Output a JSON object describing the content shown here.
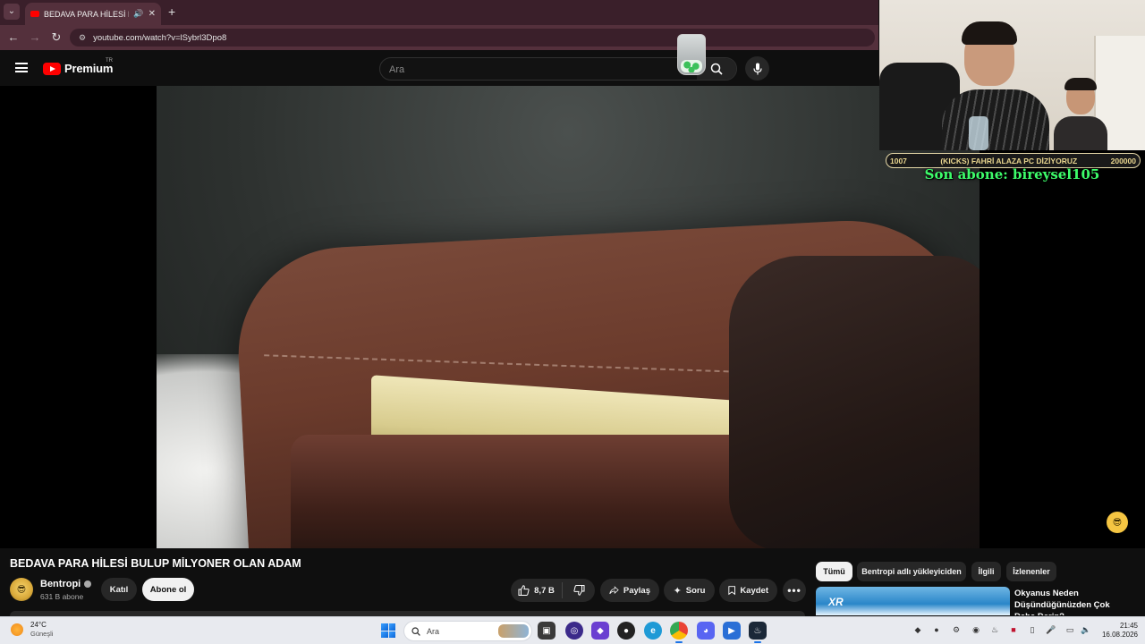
{
  "browser": {
    "tab_title": "BEDAVA PARA HİLESİ BULUP",
    "new_tab_symbol": "+",
    "url": "youtube.com/watch?v=lSybrl3Dpo8"
  },
  "youtube": {
    "logo_text": "Premium",
    "logo_region": "TR",
    "search_placeholder": "Ara"
  },
  "stream_overlay": {
    "goal_current": "1007",
    "goal_title": "(KICKS) FAHRİ ALAZA PC DİZİYORUZ",
    "goal_target": "200000",
    "last_subscriber": "Son abone: bireysel105"
  },
  "video": {
    "title": "BEDAVA PARA HİLESİ BULUP MİLYONER OLAN ADAM",
    "channel_name": "Bentropi",
    "channel_subs": "631 B abone",
    "join_label": "Katıl",
    "subscribe_label": "Abone ol",
    "like_count": "8,7 B",
    "share_label": "Paylaş",
    "ask_label": "Soru",
    "save_label": "Kaydet"
  },
  "sidebar": {
    "chips": [
      "Tümü",
      "Bentropi adlı yükleyiciden",
      "İlgili",
      "İzlenenler"
    ],
    "recommendation": {
      "thumb_text": "XR",
      "title": "Okyanus Neden Düşündüğünüzden Çok Daha Derin?"
    }
  },
  "taskbar": {
    "weather_temp": "24°C",
    "weather_condition": "Güneşli",
    "search_placeholder": "Ara",
    "time": "21:45",
    "date": "16.08.2026"
  },
  "colors": {
    "yt_background": "#0f0f0f",
    "browser_tab_bar": "#3a1f2a",
    "browser_address_bar": "#54303c",
    "youtube_red": "#ff0000",
    "goal_text": "#e9d68f",
    "last_sub_text": "#3dfc6a",
    "taskbar": "#e8eaef"
  }
}
